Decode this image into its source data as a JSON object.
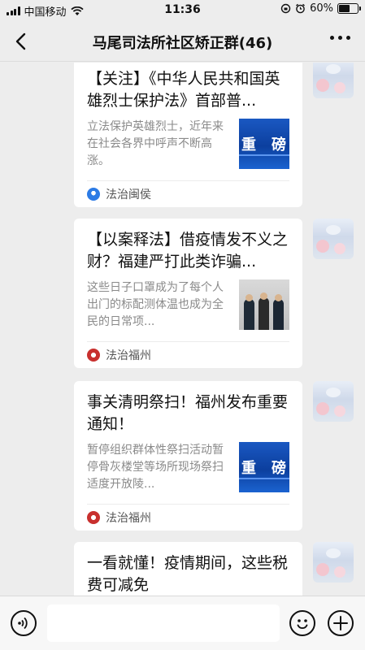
{
  "status_bar": {
    "carrier": "中国移动",
    "time": "11:36",
    "battery": "60%",
    "battery_level": 0.6
  },
  "header": {
    "title": "马尾司法所社区矫正群(46)",
    "back_icon": "chevron-left-icon",
    "more_icon": "more-dots-icon"
  },
  "messages": [
    {
      "title": "【关注】《中华人民共和国英雄烈士保护法》首部普...",
      "description": "立法保护英雄烈士，近年来在社会各界中呼声不断高涨。",
      "thumbnail": "重 磅",
      "thumb_left": "重",
      "thumb_right": "磅",
      "source": "法治闽侯"
    },
    {
      "title": "【以案释法】借疫情发不义之财？福建严打此类诈骗...",
      "description": "这些日子口罩成为了每个人出门的标配测体温也成为全民的日常项...",
      "thumbnail": "photo",
      "source": "法治福州"
    },
    {
      "title": "事关清明祭扫！福州发布重要通知！",
      "description": "暂停组织群体性祭扫活动暂停骨灰楼堂等场所现场祭扫适度开放陵...",
      "thumbnail": "重 磅",
      "thumb_left": "重",
      "thumb_right": "磅",
      "source": "法治福州"
    },
    {
      "title": "一看就懂！疫情期间，这些税费可减免",
      "description": "",
      "source": ""
    }
  ],
  "input_bar": {
    "voice_icon": "voice-icon",
    "emoji_icon": "emoji-icon",
    "plus_icon": "plus-icon",
    "placeholder": ""
  }
}
